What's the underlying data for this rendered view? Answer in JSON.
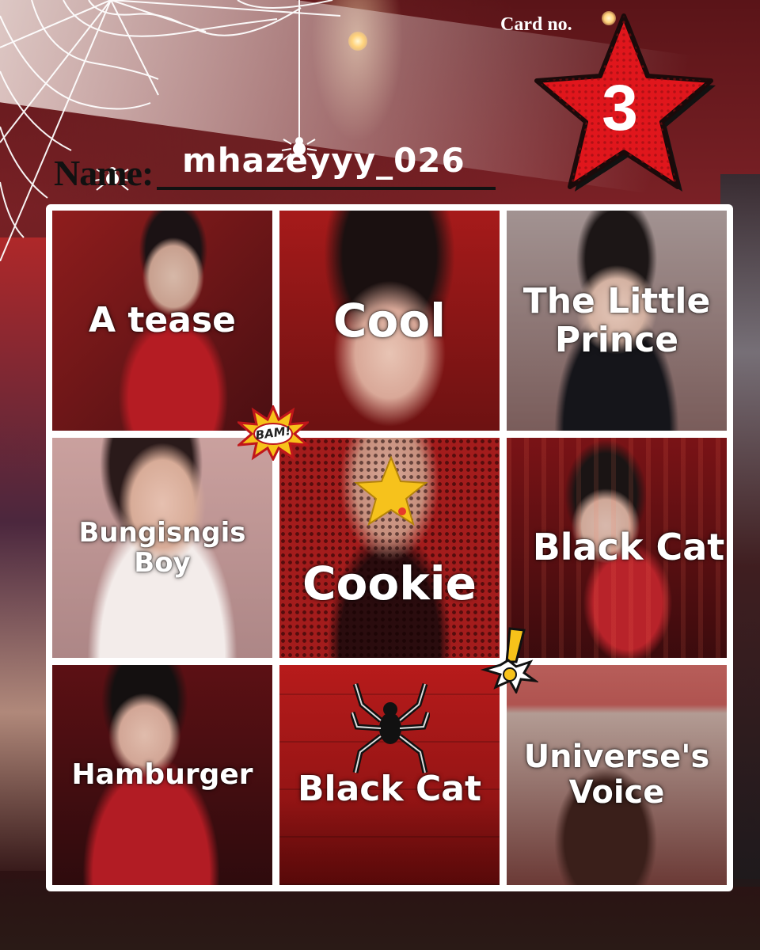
{
  "header": {
    "card_label": "Card no.",
    "card_number": "3",
    "name_label": "Name:",
    "name_value": "mhazeyyy_026"
  },
  "bingo": [
    {
      "label": "A tease"
    },
    {
      "label": "Cool"
    },
    {
      "label": "The Little Prince"
    },
    {
      "label": "Bungisngis Boy"
    },
    {
      "label": "Cookie"
    },
    {
      "label": "Black Cat"
    },
    {
      "label": "Hamburger"
    },
    {
      "label": "Black Cat"
    },
    {
      "label": "Universe's Voice"
    }
  ],
  "stickers": {
    "bam_text": "BAM!"
  },
  "colors": {
    "star_red": "#e0161c",
    "grid_border": "#ffffff",
    "label_text": "#ffffff",
    "sticker_yellow": "#f7c21a"
  }
}
